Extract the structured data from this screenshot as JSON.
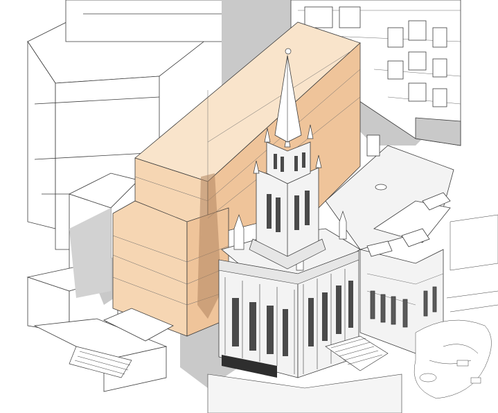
{
  "colors": {
    "background": "#ffffff",
    "line": "#3a3a3a",
    "shadow": "#c9c9c9",
    "shadow_dark": "#a9a9a9",
    "proposed_tower_front": "#f6d6b3",
    "proposed_tower_side": "#efc49a",
    "proposed_tower_top": "#f9e4cb",
    "temple_stone": "#f3f3f3",
    "temple_dark": "#5a5a5a"
  },
  "elements": {
    "proposed_tower": "proposed-tower-massing",
    "temple": "temple-building",
    "spire": "temple-spire",
    "neighbors": "neighboring-building-outlines",
    "plaza": "entry-plaza-and-stairs",
    "garden": "landscaped-garden"
  }
}
